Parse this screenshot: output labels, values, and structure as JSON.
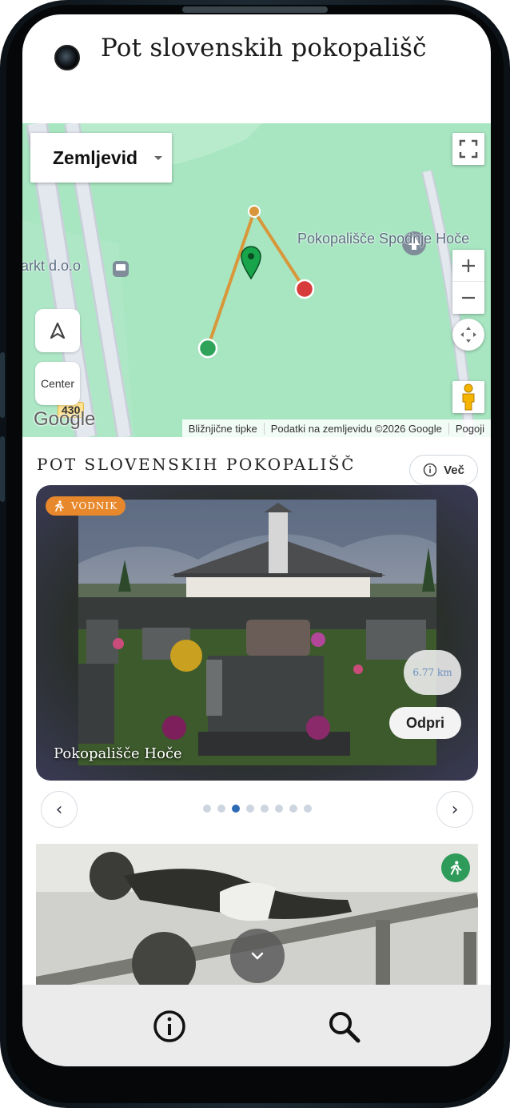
{
  "app": {
    "title": "Pot slovenskih pokopališč"
  },
  "map": {
    "type_selector": "Zemljevid",
    "center_button": "Center",
    "poi_name": "Pokopališče Spodnje Hoče",
    "business_label": "arkt d.o.o",
    "road_number": "430",
    "google_logo": "Google",
    "attribution": {
      "shortcuts": "Bližnjične tipke",
      "map_data": "Podatki na zemljevidu ©2026 Google",
      "terms": "Pogoji"
    },
    "colors": {
      "route": "#d8973a",
      "start_marker": "#2fa35a",
      "end_marker": "#d83b3b",
      "current_pin": "#17a44a",
      "land": "#a8e6c2"
    }
  },
  "section": {
    "title": "POT SLOVENSKIH POKOPALIŠČ",
    "more_label": "Več"
  },
  "card": {
    "badge": "VODNIK",
    "name": "Pokopališče Hoče",
    "distance": "6.77 km",
    "open_label": "Odpri",
    "badge_color": "#e8882c"
  },
  "carousel": {
    "prev_label": "‹",
    "next_label": "›",
    "page_count": 8,
    "active_index": 2
  },
  "icons": {
    "bottom_left": "info-icon",
    "bottom_right": "search-icon",
    "walk": "walk-icon",
    "scroll": "chevron-down-icon"
  }
}
